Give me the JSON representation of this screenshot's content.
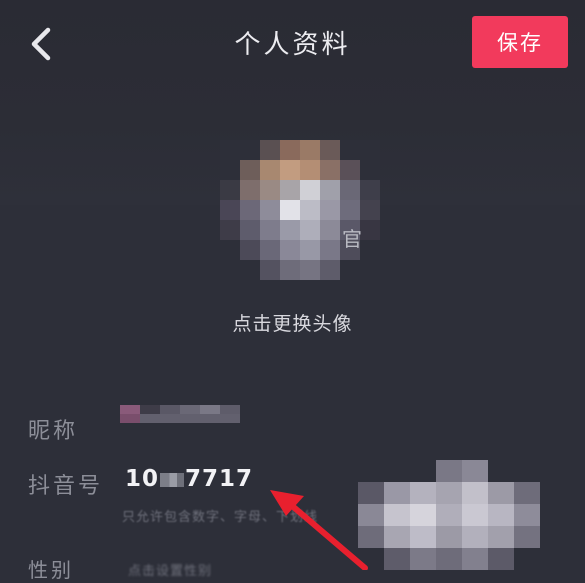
{
  "header": {
    "title": "个人资料",
    "save_label": "保存"
  },
  "avatar": {
    "hint": "点击更换头像",
    "mark": "官"
  },
  "fields": {
    "nickname": {
      "label": "昵称"
    },
    "douyin_id": {
      "label": "抖音号",
      "value_prefix": "10",
      "value_suffix": "7717",
      "hint": "只允许包含数字、字母、下划线"
    },
    "third": {
      "label": "性别",
      "value": "点击设置性别"
    }
  },
  "colors": {
    "background": "#2d2f39",
    "accent": "#f23a5c",
    "annotation_arrow": "#e8202e"
  },
  "icons": {
    "back": "chevron-left-icon"
  }
}
